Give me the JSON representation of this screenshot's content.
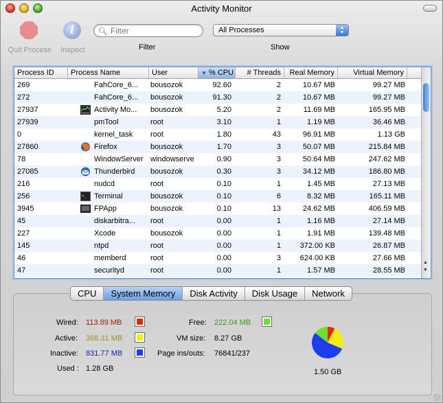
{
  "window": {
    "title": "Activity Monitor"
  },
  "toolbar": {
    "quit_label": "Quit Process",
    "inspect_label": "Inspect",
    "filter_label": "Filter",
    "filter_placeholder": "Filter",
    "show_label": "Show",
    "show_value": "All Processes"
  },
  "table": {
    "columns": [
      "Process ID",
      "Process Name",
      "User",
      "% CPU",
      "# Threads",
      "Real Memory",
      "Virtual Memory"
    ],
    "sort_indicator": "▼",
    "rows": [
      {
        "pid": "269",
        "name": "FahCore_6...",
        "user": "bousozok",
        "cpu": "92.60",
        "threads": "2",
        "real": "10.67 MB",
        "virtual": "99.27 MB",
        "icon": ""
      },
      {
        "pid": "272",
        "name": "FahCore_6...",
        "user": "bousozok",
        "cpu": "91.30",
        "threads": "2",
        "real": "10.67 MB",
        "virtual": "99.27 MB",
        "icon": ""
      },
      {
        "pid": "27937",
        "name": "Activity Mo...",
        "user": "bousozok",
        "cpu": "5.20",
        "threads": "2",
        "real": "11.69 MB",
        "virtual": "165.95 MB",
        "icon": "activity-monitor-icon"
      },
      {
        "pid": "27939",
        "name": "pmTool",
        "user": "root",
        "cpu": "3.10",
        "threads": "1",
        "real": "1.19 MB",
        "virtual": "36.46 MB",
        "icon": ""
      },
      {
        "pid": "0",
        "name": "kernel_task",
        "user": "root",
        "cpu": "1.80",
        "threads": "43",
        "real": "96.91 MB",
        "virtual": "1.13 GB",
        "icon": ""
      },
      {
        "pid": "27860",
        "name": "Firefox",
        "user": "bousozok",
        "cpu": "1.70",
        "threads": "3",
        "real": "50.07 MB",
        "virtual": "215.84 MB",
        "icon": "firefox-icon"
      },
      {
        "pid": "78",
        "name": "WindowServer",
        "user": "windowserve",
        "cpu": "0.90",
        "threads": "3",
        "real": "50.64 MB",
        "virtual": "247.62 MB",
        "icon": ""
      },
      {
        "pid": "27085",
        "name": "Thunderbird",
        "user": "bousozok",
        "cpu": "0.30",
        "threads": "3",
        "real": "34.12 MB",
        "virtual": "186.80 MB",
        "icon": "thunderbird-icon"
      },
      {
        "pid": "216",
        "name": "nudcd",
        "user": "root",
        "cpu": "0.10",
        "threads": "1",
        "real": "1.45 MB",
        "virtual": "27.13 MB",
        "icon": ""
      },
      {
        "pid": "256",
        "name": "Terminal",
        "user": "bousozok",
        "cpu": "0.10",
        "threads": "6",
        "real": "8.32 MB",
        "virtual": "165.11 MB",
        "icon": "terminal-icon"
      },
      {
        "pid": "3945",
        "name": "FPApp",
        "user": "bousozok",
        "cpu": "0.10",
        "threads": "13",
        "real": "24.62 MB",
        "virtual": "406.59 MB",
        "icon": "fpapp-icon"
      },
      {
        "pid": "45",
        "name": "diskarbitra...",
        "user": "root",
        "cpu": "0.00",
        "threads": "1",
        "real": "1.16 MB",
        "virtual": "27.14 MB",
        "icon": ""
      },
      {
        "pid": "227",
        "name": "Xcode",
        "user": "bousozok",
        "cpu": "0.00",
        "threads": "1",
        "real": "1.91 MB",
        "virtual": "139.48 MB",
        "icon": ""
      },
      {
        "pid": "145",
        "name": "ntpd",
        "user": "root",
        "cpu": "0.00",
        "threads": "1",
        "real": "372.00 KB",
        "virtual": "26.87 MB",
        "icon": ""
      },
      {
        "pid": "46",
        "name": "memberd",
        "user": "root",
        "cpu": "0.00",
        "threads": "3",
        "real": "624.00 KB",
        "virtual": "27.66 MB",
        "icon": ""
      },
      {
        "pid": "47",
        "name": "securityd",
        "user": "root",
        "cpu": "0.00",
        "threads": "1",
        "real": "1.57 MB",
        "virtual": "28.55 MB",
        "icon": ""
      }
    ]
  },
  "tabs": [
    "CPU",
    "System Memory",
    "Disk Activity",
    "Disk Usage",
    "Network"
  ],
  "active_tab": "System Memory",
  "memory": {
    "wired_label": "Wired:",
    "wired_value": "113.89 MB",
    "wired_color": "#e02a0a",
    "active_label": "Active:",
    "active_value": "368.31 MB",
    "active_color": "#f4ee10",
    "inactive_label": "Inactive:",
    "inactive_value": "831.77 MB",
    "inactive_color": "#1a3ef0",
    "free_label": "Free:",
    "free_value": "222.04 MB",
    "free_color": "#6ee02a",
    "used_label": "Used :",
    "used_value": "1.28 GB",
    "vmsize_label": "VM size:",
    "vmsize_value": "8.27 GB",
    "pageins_label": "Page ins/outs:",
    "pageins_value": "76841/237",
    "total_value": "1.50 GB"
  },
  "chart_data": {
    "type": "pie",
    "categories": [
      "Wired",
      "Active",
      "Inactive",
      "Free"
    ],
    "values": [
      113.89,
      368.31,
      831.77,
      222.04
    ],
    "colors": [
      "#e02a0a",
      "#f4ee10",
      "#1a3ef0",
      "#6ee02a"
    ]
  }
}
